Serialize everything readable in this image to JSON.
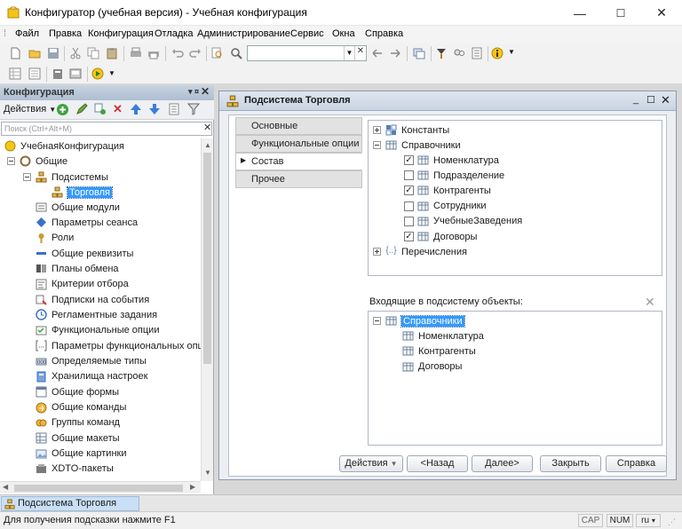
{
  "window": {
    "title": "Конфигуратор (учебная версия) - Учебная конфигурация",
    "min": "—",
    "max": "☐",
    "close": "✕"
  },
  "menu": [
    "Файл",
    "Правка",
    "Конфигурация",
    "Отладка",
    "Администрирование",
    "Сервис",
    "Окна",
    "Справка"
  ],
  "left_panel": {
    "title": "Конфигурация",
    "actions_label": "Действия",
    "search_placeholder": "Поиск (Ctrl+Alt+M)",
    "root": "УчебнаяКонфигурация",
    "general": "Общие",
    "subsystems": "Подсистемы",
    "selected_subsystem": "Торговля",
    "items": [
      "Общие модули",
      "Параметры сеанса",
      "Роли",
      "Общие реквизиты",
      "Планы обмена",
      "Критерии отбора",
      "Подписки на события",
      "Регламентные задания",
      "Функциональные опции",
      "Параметры функциональных опций",
      "Определяемые типы",
      "Хранилища настроек",
      "Общие формы",
      "Общие команды",
      "Группы команд",
      "Общие макеты",
      "Общие картинки",
      "XDTO-пакеты"
    ]
  },
  "dialog": {
    "title": "Подсистема Торговля",
    "tabs": [
      "Основные",
      "Функциональные опции",
      "Состав",
      "Прочее"
    ],
    "active_tab": "Состав",
    "tree": {
      "constants": "Константы",
      "catalogs": "Справочники",
      "catalog_items": [
        {
          "label": "Номенклатура",
          "checked": true
        },
        {
          "label": "Подразделение",
          "checked": false
        },
        {
          "label": "Контрагенты",
          "checked": true
        },
        {
          "label": "Сотрудники",
          "checked": false
        },
        {
          "label": "УчебныеЗаведения",
          "checked": false
        },
        {
          "label": "Договоры",
          "checked": true
        }
      ],
      "enums": "Перечисления"
    },
    "included_label": "Входящие в подсистему объекты:",
    "included_root": "Справочники",
    "included_items": [
      "Номенклатура",
      "Контрагенты",
      "Договоры"
    ],
    "buttons": {
      "actions": "Действия",
      "back": "<Назад",
      "next": "Далее>",
      "close": "Закрыть",
      "help": "Справка"
    }
  },
  "taskbar": {
    "item": "Подсистема Торговля"
  },
  "status": {
    "hint": "Для получения подсказки нажмите F1",
    "cap": "CAP",
    "num": "NUM",
    "lang": "ru"
  }
}
